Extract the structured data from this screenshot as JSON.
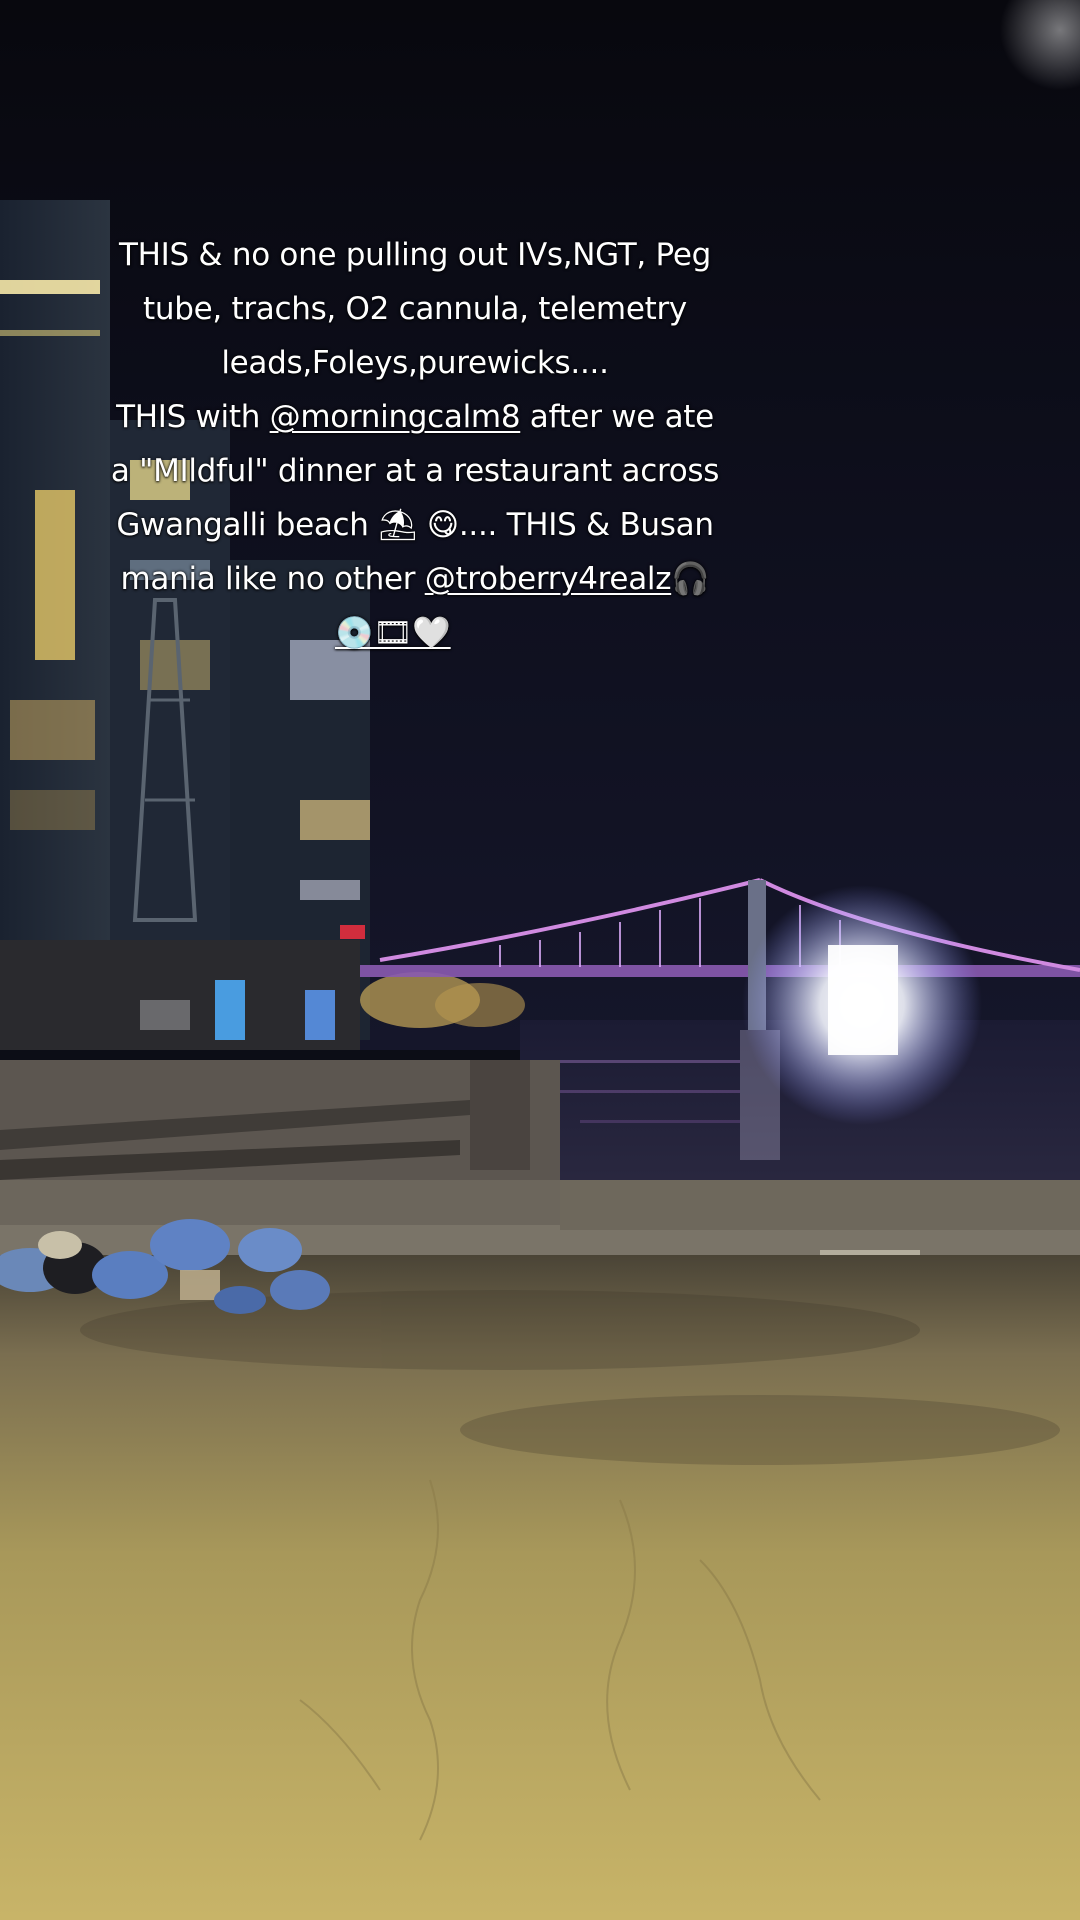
{
  "caption": {
    "line1": "THIS & no one pulling out IVs,NGT, Peg",
    "line2": "tube, trachs, O2 cannula, telemetry",
    "line3": "leads,Foleys,purewicks....",
    "line4_pre": "THIS with ",
    "mention1": "@morningcalm8",
    "line4_post": " after we ate",
    "line5": "a \"MIldful\" dinner at a restaurant across",
    "line6_pre": "Gwangalli beach ",
    "line6_emojis": "⛱ 😋",
    "line6_post": ".... THIS & Busan",
    "line7_pre": "mania like no other ",
    "mention2": "@troberry4realz",
    "line7_emoji": "🎧",
    "line8_emojis": "💿🎞🤍"
  },
  "colors": {
    "sky": "#0c0d16",
    "sand": "#c8b468",
    "bridge_lights": "#c07adf",
    "flood_light": "#ffffff"
  }
}
